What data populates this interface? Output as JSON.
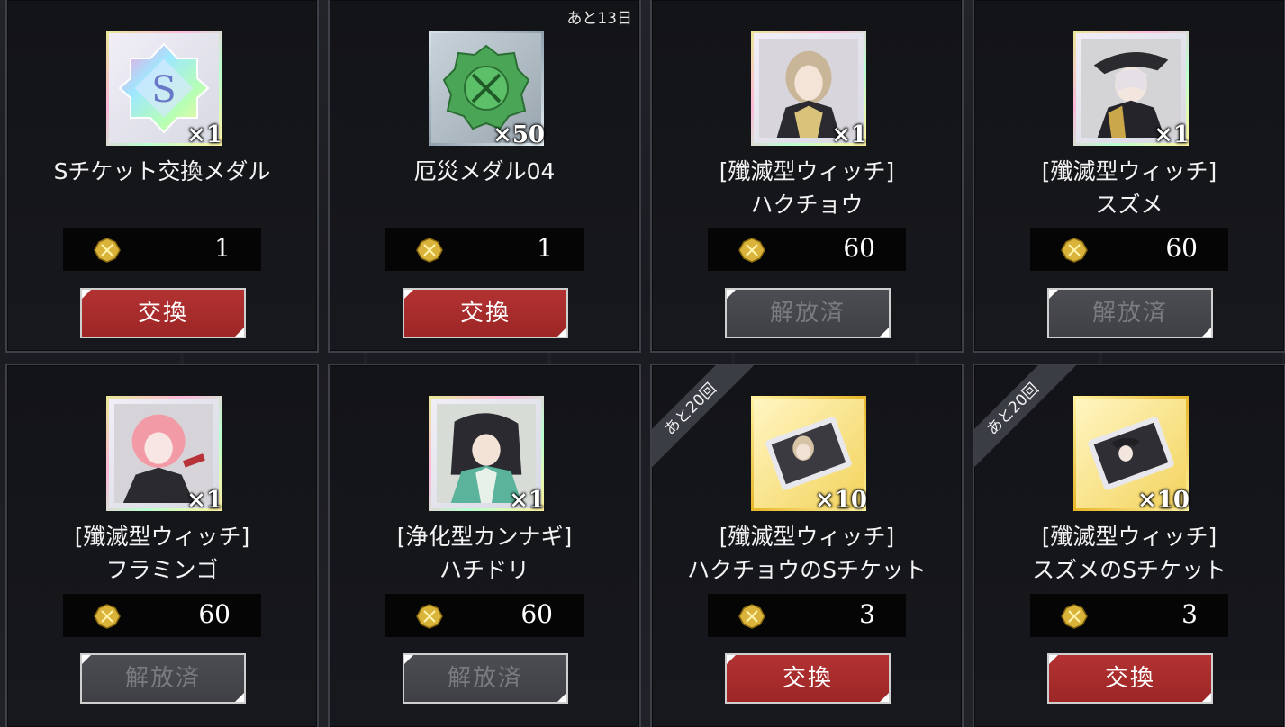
{
  "cards": [
    {
      "name_line1": "Sチケット交換メダル",
      "name_line2": "",
      "qty": "×1",
      "price": "1",
      "button": "交換",
      "remaining": "",
      "ribbon": "",
      "icon": "s-ticket-medal-icon"
    },
    {
      "name_line1": "厄災メダル04",
      "name_line2": "",
      "qty": "×50",
      "price": "1",
      "button": "交換",
      "remaining": "あと13日",
      "ribbon": "",
      "icon": "calamity-medal-icon"
    },
    {
      "name_line1": "[殲滅型ウィッチ]",
      "name_line2": "ハクチョウ",
      "qty": "×1",
      "price": "60",
      "button": "解放済",
      "remaining": "",
      "ribbon": "",
      "icon": "character-portrait-icon"
    },
    {
      "name_line1": "[殲滅型ウィッチ]",
      "name_line2": "スズメ",
      "qty": "×1",
      "price": "60",
      "button": "解放済",
      "remaining": "",
      "ribbon": "",
      "icon": "character-portrait-icon"
    },
    {
      "name_line1": "[殲滅型ウィッチ]",
      "name_line2": "フラミンゴ",
      "qty": "×1",
      "price": "60",
      "button": "解放済",
      "remaining": "",
      "ribbon": "",
      "icon": "character-portrait-icon"
    },
    {
      "name_line1": "[浄化型カンナギ]",
      "name_line2": "ハチドリ",
      "qty": "×1",
      "price": "60",
      "button": "解放済",
      "remaining": "",
      "ribbon": "",
      "icon": "character-portrait-icon"
    },
    {
      "name_line1": "[殲滅型ウィッチ]",
      "name_line2": "ハクチョウのSチケット",
      "qty": "×10",
      "price": "3",
      "button": "交換",
      "remaining": "",
      "ribbon": "あと20回",
      "icon": "s-ticket-icon"
    },
    {
      "name_line1": "[殲滅型ウィッチ]",
      "name_line2": "スズメのSチケット",
      "qty": "×10",
      "price": "3",
      "button": "交換",
      "remaining": "",
      "ribbon": "あと20回",
      "icon": "s-ticket-icon"
    }
  ],
  "colors": {
    "exchange_button": "#a82c2c",
    "released_button": "#46474d",
    "coin": "#d9b33a"
  }
}
